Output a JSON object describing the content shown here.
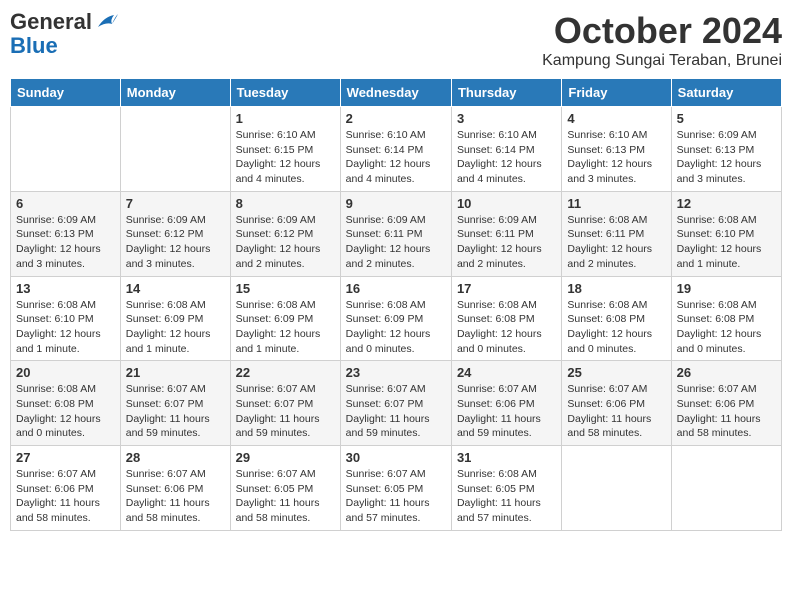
{
  "logo": {
    "general": "General",
    "blue": "Blue"
  },
  "title": "October 2024",
  "location": "Kampung Sungai Teraban, Brunei",
  "headers": [
    "Sunday",
    "Monday",
    "Tuesday",
    "Wednesday",
    "Thursday",
    "Friday",
    "Saturday"
  ],
  "weeks": [
    [
      {
        "day": "",
        "detail": ""
      },
      {
        "day": "",
        "detail": ""
      },
      {
        "day": "1",
        "detail": "Sunrise: 6:10 AM\nSunset: 6:15 PM\nDaylight: 12 hours and 4 minutes."
      },
      {
        "day": "2",
        "detail": "Sunrise: 6:10 AM\nSunset: 6:14 PM\nDaylight: 12 hours and 4 minutes."
      },
      {
        "day": "3",
        "detail": "Sunrise: 6:10 AM\nSunset: 6:14 PM\nDaylight: 12 hours and 4 minutes."
      },
      {
        "day": "4",
        "detail": "Sunrise: 6:10 AM\nSunset: 6:13 PM\nDaylight: 12 hours and 3 minutes."
      },
      {
        "day": "5",
        "detail": "Sunrise: 6:09 AM\nSunset: 6:13 PM\nDaylight: 12 hours and 3 minutes."
      }
    ],
    [
      {
        "day": "6",
        "detail": "Sunrise: 6:09 AM\nSunset: 6:13 PM\nDaylight: 12 hours and 3 minutes."
      },
      {
        "day": "7",
        "detail": "Sunrise: 6:09 AM\nSunset: 6:12 PM\nDaylight: 12 hours and 3 minutes."
      },
      {
        "day": "8",
        "detail": "Sunrise: 6:09 AM\nSunset: 6:12 PM\nDaylight: 12 hours and 2 minutes."
      },
      {
        "day": "9",
        "detail": "Sunrise: 6:09 AM\nSunset: 6:11 PM\nDaylight: 12 hours and 2 minutes."
      },
      {
        "day": "10",
        "detail": "Sunrise: 6:09 AM\nSunset: 6:11 PM\nDaylight: 12 hours and 2 minutes."
      },
      {
        "day": "11",
        "detail": "Sunrise: 6:08 AM\nSunset: 6:11 PM\nDaylight: 12 hours and 2 minutes."
      },
      {
        "day": "12",
        "detail": "Sunrise: 6:08 AM\nSunset: 6:10 PM\nDaylight: 12 hours and 1 minute."
      }
    ],
    [
      {
        "day": "13",
        "detail": "Sunrise: 6:08 AM\nSunset: 6:10 PM\nDaylight: 12 hours and 1 minute."
      },
      {
        "day": "14",
        "detail": "Sunrise: 6:08 AM\nSunset: 6:09 PM\nDaylight: 12 hours and 1 minute."
      },
      {
        "day": "15",
        "detail": "Sunrise: 6:08 AM\nSunset: 6:09 PM\nDaylight: 12 hours and 1 minute."
      },
      {
        "day": "16",
        "detail": "Sunrise: 6:08 AM\nSunset: 6:09 PM\nDaylight: 12 hours and 0 minutes."
      },
      {
        "day": "17",
        "detail": "Sunrise: 6:08 AM\nSunset: 6:08 PM\nDaylight: 12 hours and 0 minutes."
      },
      {
        "day": "18",
        "detail": "Sunrise: 6:08 AM\nSunset: 6:08 PM\nDaylight: 12 hours and 0 minutes."
      },
      {
        "day": "19",
        "detail": "Sunrise: 6:08 AM\nSunset: 6:08 PM\nDaylight: 12 hours and 0 minutes."
      }
    ],
    [
      {
        "day": "20",
        "detail": "Sunrise: 6:08 AM\nSunset: 6:08 PM\nDaylight: 12 hours and 0 minutes."
      },
      {
        "day": "21",
        "detail": "Sunrise: 6:07 AM\nSunset: 6:07 PM\nDaylight: 11 hours and 59 minutes."
      },
      {
        "day": "22",
        "detail": "Sunrise: 6:07 AM\nSunset: 6:07 PM\nDaylight: 11 hours and 59 minutes."
      },
      {
        "day": "23",
        "detail": "Sunrise: 6:07 AM\nSunset: 6:07 PM\nDaylight: 11 hours and 59 minutes."
      },
      {
        "day": "24",
        "detail": "Sunrise: 6:07 AM\nSunset: 6:06 PM\nDaylight: 11 hours and 59 minutes."
      },
      {
        "day": "25",
        "detail": "Sunrise: 6:07 AM\nSunset: 6:06 PM\nDaylight: 11 hours and 58 minutes."
      },
      {
        "day": "26",
        "detail": "Sunrise: 6:07 AM\nSunset: 6:06 PM\nDaylight: 11 hours and 58 minutes."
      }
    ],
    [
      {
        "day": "27",
        "detail": "Sunrise: 6:07 AM\nSunset: 6:06 PM\nDaylight: 11 hours and 58 minutes."
      },
      {
        "day": "28",
        "detail": "Sunrise: 6:07 AM\nSunset: 6:06 PM\nDaylight: 11 hours and 58 minutes."
      },
      {
        "day": "29",
        "detail": "Sunrise: 6:07 AM\nSunset: 6:05 PM\nDaylight: 11 hours and 58 minutes."
      },
      {
        "day": "30",
        "detail": "Sunrise: 6:07 AM\nSunset: 6:05 PM\nDaylight: 11 hours and 57 minutes."
      },
      {
        "day": "31",
        "detail": "Sunrise: 6:08 AM\nSunset: 6:05 PM\nDaylight: 11 hours and 57 minutes."
      },
      {
        "day": "",
        "detail": ""
      },
      {
        "day": "",
        "detail": ""
      }
    ]
  ]
}
